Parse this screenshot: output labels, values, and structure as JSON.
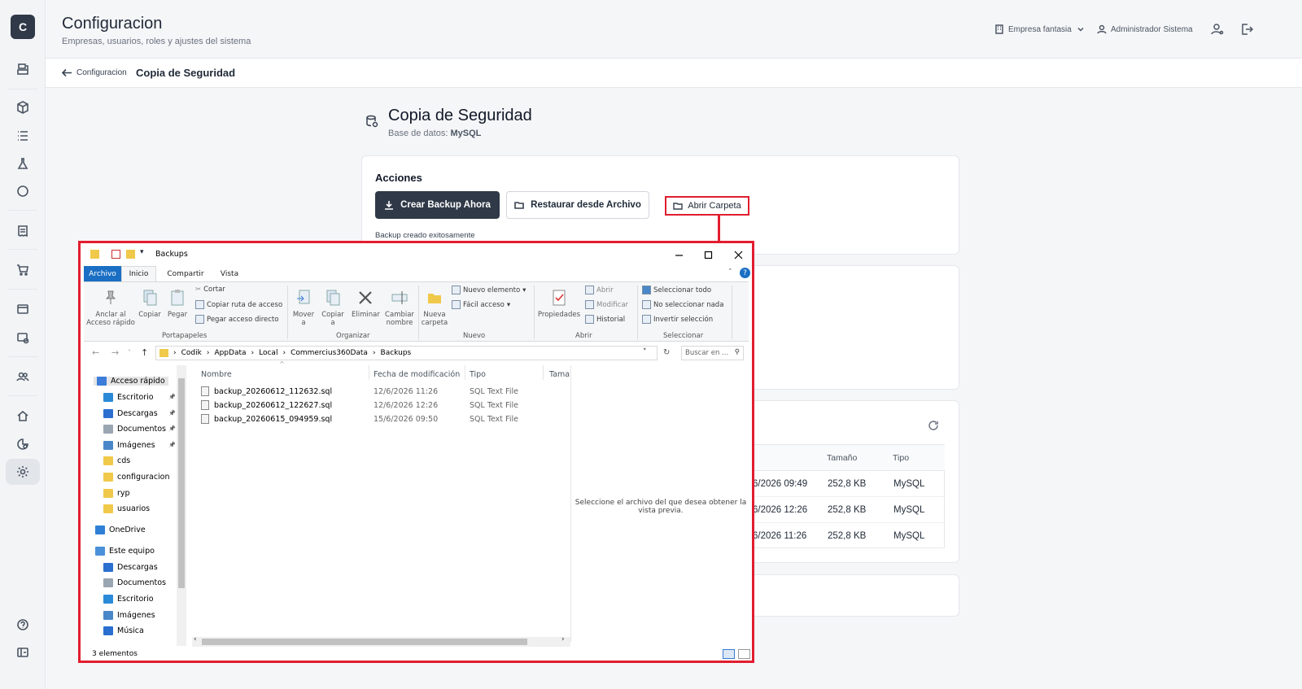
{
  "sidebar": {
    "logo": "C",
    "icons": [
      "cash-register-icon",
      "box-icon",
      "list-icon",
      "flask-icon",
      "circle-icon",
      "receipt-icon",
      "cart-icon",
      "card-icon",
      "database-settings-icon",
      "users-icon",
      "home-icon",
      "chart-search-icon",
      "gear-icon",
      "help-icon",
      "collapse-icon"
    ]
  },
  "header": {
    "title": "Configuracion",
    "subtitle": "Empresas, usuarios, roles y ajustes del sistema",
    "company": "Empresa fantasia",
    "user": "Administrador Sistema"
  },
  "breadcrumb": {
    "back_label": "Configuracion",
    "current": "Copia de Seguridad"
  },
  "page": {
    "title": "Copia de Seguridad",
    "db_label": "Base de datos:",
    "db_value": "MySQL"
  },
  "actions": {
    "title": "Acciones",
    "create_backup": "Crear Backup Ahora",
    "restore": "Restaurar desde Archivo",
    "open_folder": "Abrir Carpeta",
    "success_msg": "Backup creado exitosamente"
  },
  "backups_table": {
    "headers": {
      "size": "Tamaño",
      "type": "Tipo"
    },
    "rows": [
      {
        "date": "6/2026 09:49",
        "size": "252,8 KB",
        "type": "MySQL"
      },
      {
        "date": "6/2026 12:26",
        "size": "252,8 KB",
        "type": "MySQL"
      },
      {
        "date": "6/2026 11:26",
        "size": "252,8 KB",
        "type": "MySQL"
      }
    ]
  },
  "explorer": {
    "title": "Backups",
    "tabs": [
      "Archivo",
      "Inicio",
      "Compartir",
      "Vista"
    ],
    "ribbon": {
      "pin": "Anclar al\nAcceso rápido",
      "copy": "Copiar",
      "paste": "Pegar",
      "cut": "Cortar",
      "copy_path": "Copiar ruta de acceso",
      "paste_shortcut": "Pegar acceso directo",
      "group_clipboard": "Portapapeles",
      "move_to": "Mover\na",
      "copy_to": "Copiar\na",
      "delete": "Eliminar",
      "rename": "Cambiar\nnombre",
      "group_organize": "Organizar",
      "new_folder": "Nueva\ncarpeta",
      "new_item": "Nuevo elemento",
      "easy_access": "Fácil acceso",
      "group_new": "Nuevo",
      "properties": "Propiedades",
      "open": "Abrir",
      "edit": "Modificar",
      "history": "Historial",
      "group_open": "Abrir",
      "select_all": "Seleccionar todo",
      "select_none": "No seleccionar nada",
      "invert": "Invertir selección",
      "group_select": "Seleccionar"
    },
    "path": [
      "Codik",
      "AppData",
      "Local",
      "Commercius360Data",
      "Backups"
    ],
    "search_placeholder": "Buscar en ...",
    "nav": [
      {
        "label": "Acceso rápido",
        "icon": "star-icon",
        "color": "#3b7dd8"
      },
      {
        "label": "Escritorio",
        "icon": "desktop-icon",
        "color": "#2b8ad8",
        "pinned": true
      },
      {
        "label": "Descargas",
        "icon": "download-icon",
        "color": "#2b6fd0",
        "pinned": true
      },
      {
        "label": "Documentos",
        "icon": "document-icon",
        "color": "#9aa6b2",
        "pinned": true
      },
      {
        "label": "Imágenes",
        "icon": "image-icon",
        "color": "#4a87c8",
        "pinned": true
      },
      {
        "label": "cds",
        "icon": "folder-icon",
        "color": "#f0c94a"
      },
      {
        "label": "configuracion",
        "icon": "folder-icon",
        "color": "#f0c94a"
      },
      {
        "label": "ryp",
        "icon": "folder-icon",
        "color": "#f0c94a"
      },
      {
        "label": "usuarios",
        "icon": "folder-icon",
        "color": "#f0c94a"
      },
      {
        "label": "OneDrive",
        "icon": "cloud-icon",
        "color": "#2f7fd6"
      },
      {
        "label": "Este equipo",
        "icon": "computer-icon",
        "color": "#4a90d9"
      },
      {
        "label": "Descargas",
        "icon": "download-icon",
        "color": "#2b6fd0"
      },
      {
        "label": "Documentos",
        "icon": "document-icon",
        "color": "#9aa6b2"
      },
      {
        "label": "Escritorio",
        "icon": "desktop-icon",
        "color": "#2b8ad8"
      },
      {
        "label": "Imágenes",
        "icon": "image-icon",
        "color": "#4a87c8"
      },
      {
        "label": "Música",
        "icon": "music-icon",
        "color": "#2b6fd0"
      }
    ],
    "columns": {
      "name": "Nombre",
      "date": "Fecha de modificación",
      "type": "Tipo",
      "size": "Tama"
    },
    "files": [
      {
        "name": "backup_20260612_112632.sql",
        "date": "12/6/2026 11:26",
        "type": "SQL Text File"
      },
      {
        "name": "backup_20260612_122627.sql",
        "date": "12/6/2026 12:26",
        "type": "SQL Text File"
      },
      {
        "name": "backup_20260615_094959.sql",
        "date": "15/6/2026 09:50",
        "type": "SQL Text File"
      }
    ],
    "preview_msg": "Seleccione el archivo del que desea obtener la vista previa.",
    "status": "3 elementos"
  },
  "colors": {
    "accent": "#2f3947",
    "highlight": "#e11d2e",
    "explorer_blue": "#1a6fc4"
  }
}
